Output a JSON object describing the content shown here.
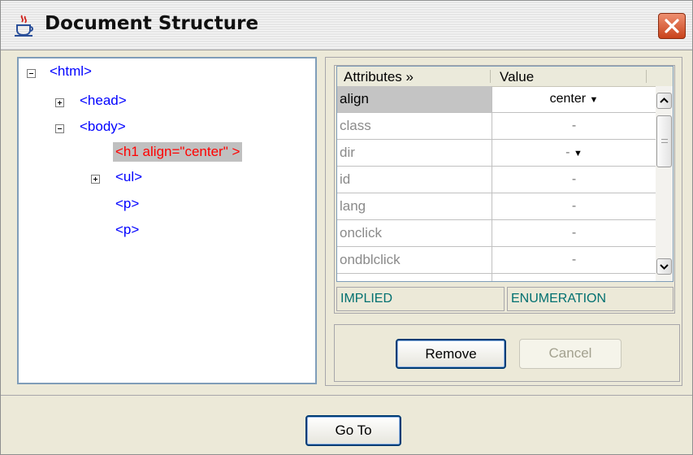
{
  "window": {
    "title": "Document Structure",
    "close_icon": "close-icon",
    "app_icon": "java-cup-icon"
  },
  "tree": {
    "nodes": [
      {
        "label": "<html>",
        "toggle": "minus"
      },
      {
        "label": "<head>",
        "toggle": "plus"
      },
      {
        "label": "<body>",
        "toggle": "minus"
      },
      {
        "label": "<h1 align=\"center\" >",
        "selected": true
      },
      {
        "label": "<ul>",
        "toggle": "plus"
      },
      {
        "label": "<p>"
      },
      {
        "label": "<p>"
      }
    ]
  },
  "attributes": {
    "header_name": "Attributes »",
    "header_value": "Value",
    "rows": [
      {
        "name": "align",
        "value": "center",
        "dropdown": true
      },
      {
        "name": "class",
        "value": "-"
      },
      {
        "name": "dir",
        "value": "-",
        "dropdown": true
      },
      {
        "name": "id",
        "value": "-"
      },
      {
        "name": "lang",
        "value": "-"
      },
      {
        "name": "onclick",
        "value": "-"
      },
      {
        "name": "ondblclick",
        "value": "-"
      }
    ],
    "status_left": "IMPLIED",
    "status_right": "ENUMERATION"
  },
  "buttons": {
    "remove": "Remove",
    "cancel": "Cancel",
    "goto": "Go To"
  },
  "colors": {
    "tree_text": "#0000ff",
    "selected_text": "#ff0000",
    "status_text": "#007070"
  }
}
